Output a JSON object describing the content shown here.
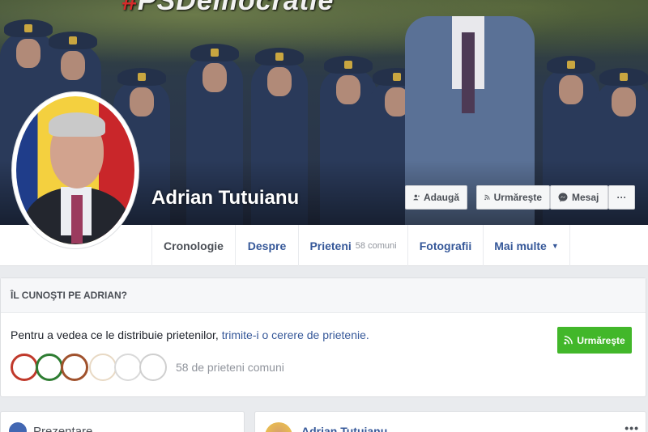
{
  "cover": {
    "banner_text": "#PSDemocratie"
  },
  "profile": {
    "name": "Adrian Tutuianu",
    "buttons": {
      "add_friend": "Adaugă",
      "follow": "Urmăreşte",
      "message": "Mesaj",
      "more": "···"
    }
  },
  "tabs": [
    {
      "label": "Cronologie"
    },
    {
      "label": "Despre"
    },
    {
      "label": "Prieteni",
      "count": "58 comuni"
    },
    {
      "label": "Fotografii"
    },
    {
      "label": "Mai multe",
      "caret": "▼"
    }
  ],
  "know_card": {
    "heading": "ÎL CUNOŞTI PE ADRIAN?",
    "text_before": "Pentru a vedea ce le distribuie prietenilor, ",
    "link_text": "trimite-i o cerere de prietenie.",
    "follow_button": "Urmăreşte",
    "mutual_friends": "58 de prieteni comuni",
    "friend_colors": [
      "#c0392b",
      "#2e7d32",
      "#a0522d",
      "#e8d9c4",
      "#d9d9d9",
      "#f0f0f0"
    ]
  },
  "intro_card": {
    "label": "Prezentare"
  },
  "post": {
    "author": "Adrian Tutuianu",
    "menu": "•••"
  },
  "colors": {
    "fb_blue": "#365899",
    "green": "#42b72a",
    "bg": "#e9ebee"
  }
}
